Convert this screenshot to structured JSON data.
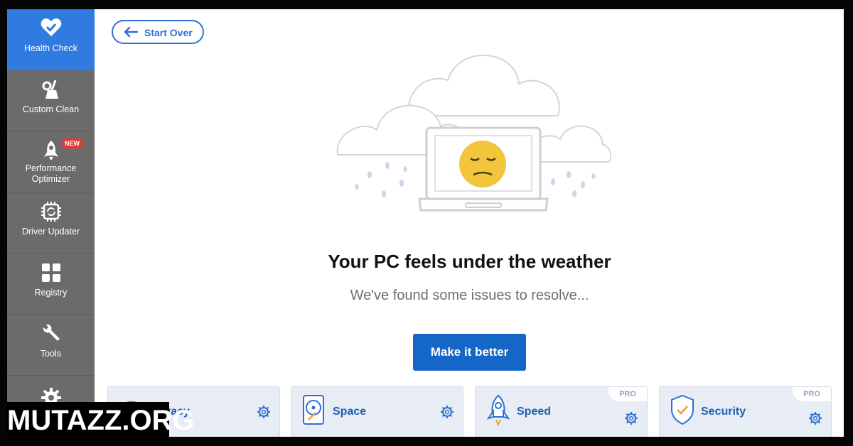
{
  "sidebar": {
    "items": [
      {
        "label": "Health Check",
        "icon": "heart-check-icon",
        "active": true
      },
      {
        "label": "Custom Clean",
        "icon": "broom-icon"
      },
      {
        "label": "Performance Optimizer",
        "icon": "rocket-icon",
        "badge": "NEW"
      },
      {
        "label": "Driver Updater",
        "icon": "chip-refresh-icon"
      },
      {
        "label": "Registry",
        "icon": "grid-icon"
      },
      {
        "label": "Tools",
        "icon": "wrench-icon"
      },
      {
        "label": "",
        "icon": "gear-icon"
      }
    ]
  },
  "header": {
    "start_over_label": "Start Over"
  },
  "main": {
    "headline": "Your PC feels under the weather",
    "subline": "We've found some issues to resolve...",
    "cta_label": "Make it better"
  },
  "cards": [
    {
      "label": "Privacy",
      "icon": "privacy-icon"
    },
    {
      "label": "Space",
      "icon": "hard-drive-icon"
    },
    {
      "label": "Speed",
      "icon": "rocket-icon",
      "pro": "PRO"
    },
    {
      "label": "Security",
      "icon": "shield-check-icon",
      "pro": "PRO"
    }
  ],
  "watermark": "MUTAZZ.ORG",
  "colors": {
    "accent": "#2f7be0",
    "button": "#1467c7",
    "sidebar": "#6b6b6b",
    "card_bg": "#e8ecf5",
    "face": "#f2c53d"
  }
}
